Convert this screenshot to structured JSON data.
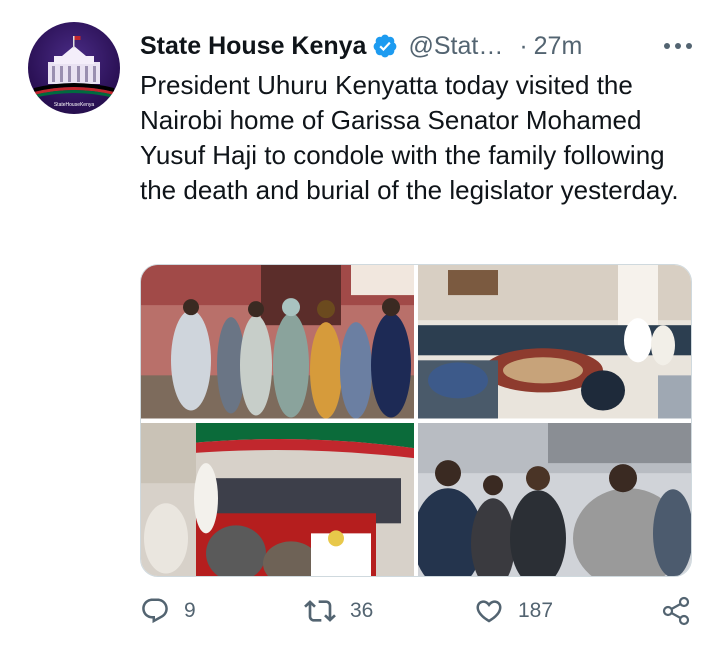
{
  "tweet": {
    "author_name": "State House Kenya",
    "handle": "@Stat…",
    "separator": "·",
    "time": "27m",
    "text": "President Uhuru Kenyatta today visited the Nairobi home of Garissa Senator Mohamed Yusuf Haji to condole with the family following the death and burial of the legislator yesterday."
  },
  "avatar": {
    "logo_text": "StateHouseKenya"
  },
  "metrics": {
    "replies": "9",
    "retweets": "36",
    "likes": "187"
  },
  "icons": {
    "verified": "verified-badge-icon",
    "more": "more-options-icon",
    "reply": "reply-icon",
    "retweet": "retweet-icon",
    "like": "like-heart-icon",
    "share": "share-icon"
  },
  "colors": {
    "text_primary": "#0f1419",
    "text_secondary": "#536471",
    "verified_blue": "#1d9bf0",
    "border": "#cfd9de"
  }
}
